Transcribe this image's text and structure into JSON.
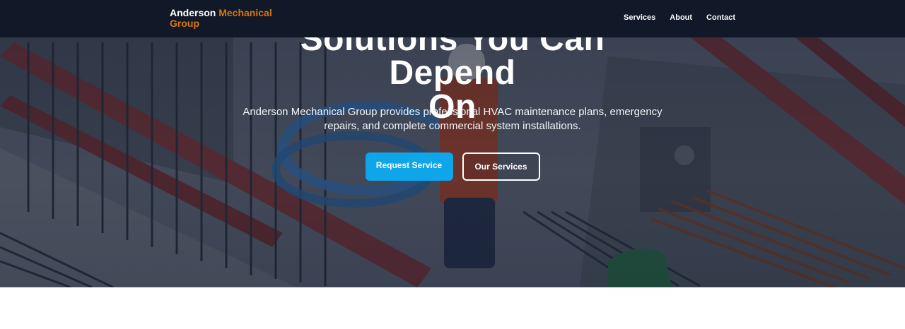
{
  "header": {
    "brand_primary": "Anderson",
    "brand_accent": "Mechanical",
    "brand_line2": "Group",
    "nav": [
      {
        "label": "Services"
      },
      {
        "label": "About"
      },
      {
        "label": "Contact"
      }
    ]
  },
  "hero": {
    "title_line1": "Solutions You Can Depend",
    "title_line2": "On",
    "subtitle": "Anderson Mechanical Group provides professional HVAC maintenance plans, emergency repairs, and complete commercial system installations.",
    "primary_cta": "Request Service",
    "secondary_cta": "Our Services",
    "background": "construction-site-photo"
  },
  "colors": {
    "nav_bg": "#111827",
    "brand_accent": "#d97706",
    "primary_button": "#0ea5e9",
    "white": "#ffffff"
  }
}
